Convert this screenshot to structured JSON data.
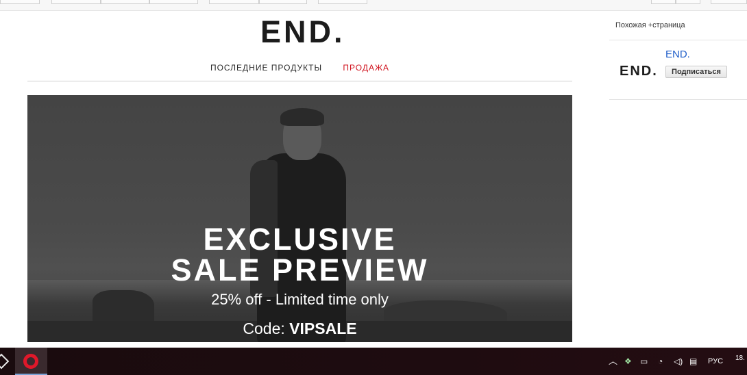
{
  "email": {
    "brand_logo": "END.",
    "nav": {
      "latest": "ПОСЛЕДНИЕ ПРОДУКТЫ",
      "sale": "ПРОДАЖА"
    },
    "hero": {
      "line1": "EXCLUSIVE",
      "line2": "SALE PREVIEW",
      "subline": "25% off - Limited time only",
      "code_label": "Code:",
      "code_value": "VIPSALE"
    }
  },
  "sidebar": {
    "similar_label": "Похожая +страница",
    "sender_logo": "END.",
    "sender_name": "END.",
    "subscribe_label": "Подписаться"
  },
  "taskbar": {
    "language": "РУС",
    "clock": "18.",
    "icons": [
      "start-icon",
      "opera-icon",
      "chevron-up-icon",
      "dropbox-icon",
      "battery-icon",
      "wifi-icon",
      "volume-icon",
      "notification-icon"
    ]
  },
  "colors": {
    "sale_red": "#d0121d",
    "link_blue": "#1f5ec9",
    "opera_red": "#e0182a"
  }
}
